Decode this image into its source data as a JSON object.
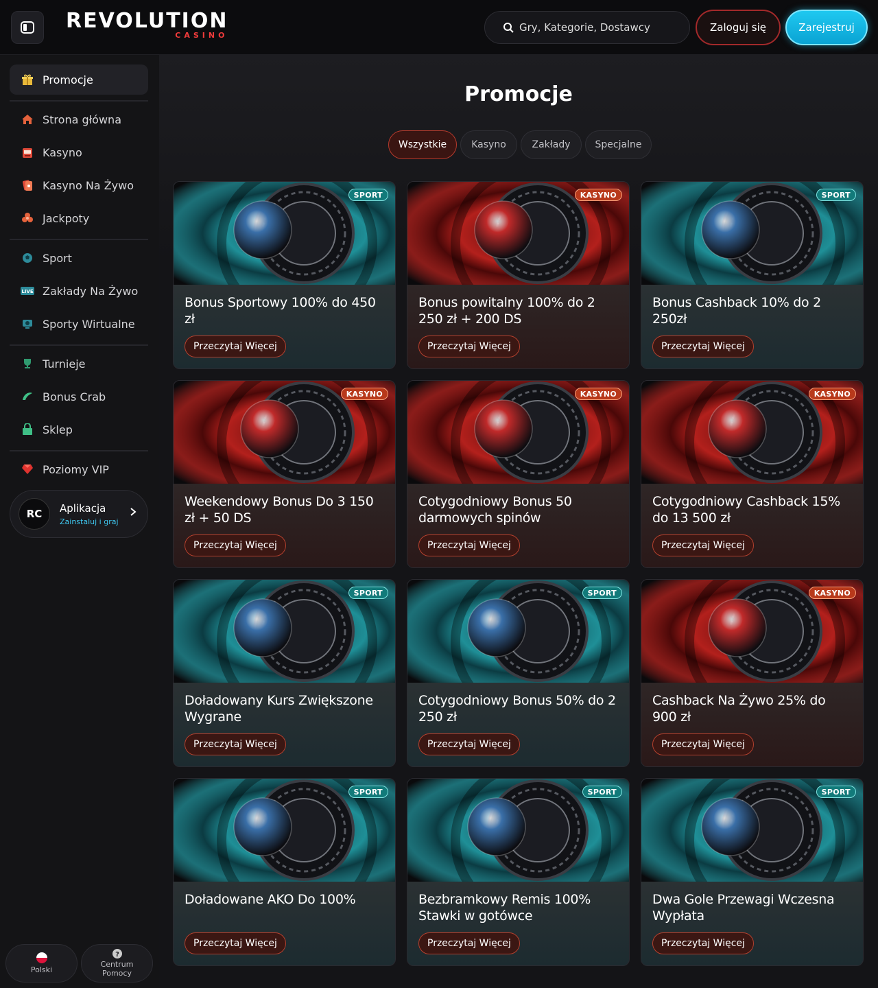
{
  "header": {
    "logo_main": "REVOLUTION",
    "logo_sub": "CASINO",
    "search_placeholder": "Gry, Kategorie, Dostawcy",
    "login": "Zaloguj się",
    "register": "Zarejestruj"
  },
  "sidebar": {
    "items": [
      {
        "label": "Promocje",
        "icon": "gift-icon"
      },
      {
        "label": "Strona główna",
        "icon": "home-icon"
      },
      {
        "label": "Kasyno",
        "icon": "slot-machine-icon"
      },
      {
        "label": "Kasyno Na Żywo",
        "icon": "live-cards-icon"
      },
      {
        "label": "Jackpoty",
        "icon": "jackpot-icon"
      },
      {
        "label": "Sport",
        "icon": "soccer-ball-icon"
      },
      {
        "label": "Zakłady Na Żywo",
        "icon": "live-badge-icon"
      },
      {
        "label": "Sporty Wirtualne",
        "icon": "virtual-sports-icon"
      },
      {
        "label": "Turnieje",
        "icon": "trophy-icon"
      },
      {
        "label": "Bonus Crab",
        "icon": "claw-icon"
      },
      {
        "label": "Sklep",
        "icon": "shop-icon"
      },
      {
        "label": "Poziomy VIP",
        "icon": "diamond-icon"
      }
    ],
    "app": {
      "title": "Aplikacja",
      "subtitle": "Zainstaluj i graj",
      "icon_text": "RC"
    },
    "footer": {
      "language": "Polski",
      "help": "Centrum Pomocy"
    }
  },
  "main": {
    "title": "Promocje",
    "filters": [
      "Wszystkie",
      "Kasyno",
      "Zakłady",
      "Specjalne"
    ],
    "active_filter": "Wszystkie",
    "read_more": "Przeczytaj Więcej",
    "cards": [
      {
        "title": "Bonus Sportowy 100% do 450 zł",
        "tag": "SPORT"
      },
      {
        "title": "Bonus powitalny 100% do 2 250 zł + 200 DS",
        "tag": "KASYNO"
      },
      {
        "title": "Bonus Cashback 10% do 2 250zł",
        "tag": "SPORT"
      },
      {
        "title": "Weekendowy Bonus Do 3 150 zł + 50 DS",
        "tag": "KASYNO"
      },
      {
        "title": "Cotygodniowy Bonus 50 darmowych spinów",
        "tag": "KASYNO"
      },
      {
        "title": "Cotygodniowy Cashback 15% do 13 500 zł",
        "tag": "KASYNO"
      },
      {
        "title": "Doładowany Kurs Zwiększone Wygrane",
        "tag": "SPORT"
      },
      {
        "title": "Cotygodniowy Bonus 50% do 2 250 zł",
        "tag": "SPORT"
      },
      {
        "title": "Cashback Na Żywo 25% do 900 zł",
        "tag": "KASYNO"
      },
      {
        "title": "Doładowane AKO Do 100%",
        "tag": "SPORT"
      },
      {
        "title": "Bezbramkowy Remis 100% Stawki w gotówce",
        "tag": "SPORT"
      },
      {
        "title": "Dwa Gole Przewagi Wczesna Wypłata",
        "tag": "SPORT"
      }
    ]
  },
  "colors": {
    "accent_red": "#b63a2c",
    "accent_cyan": "#1fc8f0",
    "sport_teal": "#127a7a",
    "casino_red": "#b8391b"
  }
}
